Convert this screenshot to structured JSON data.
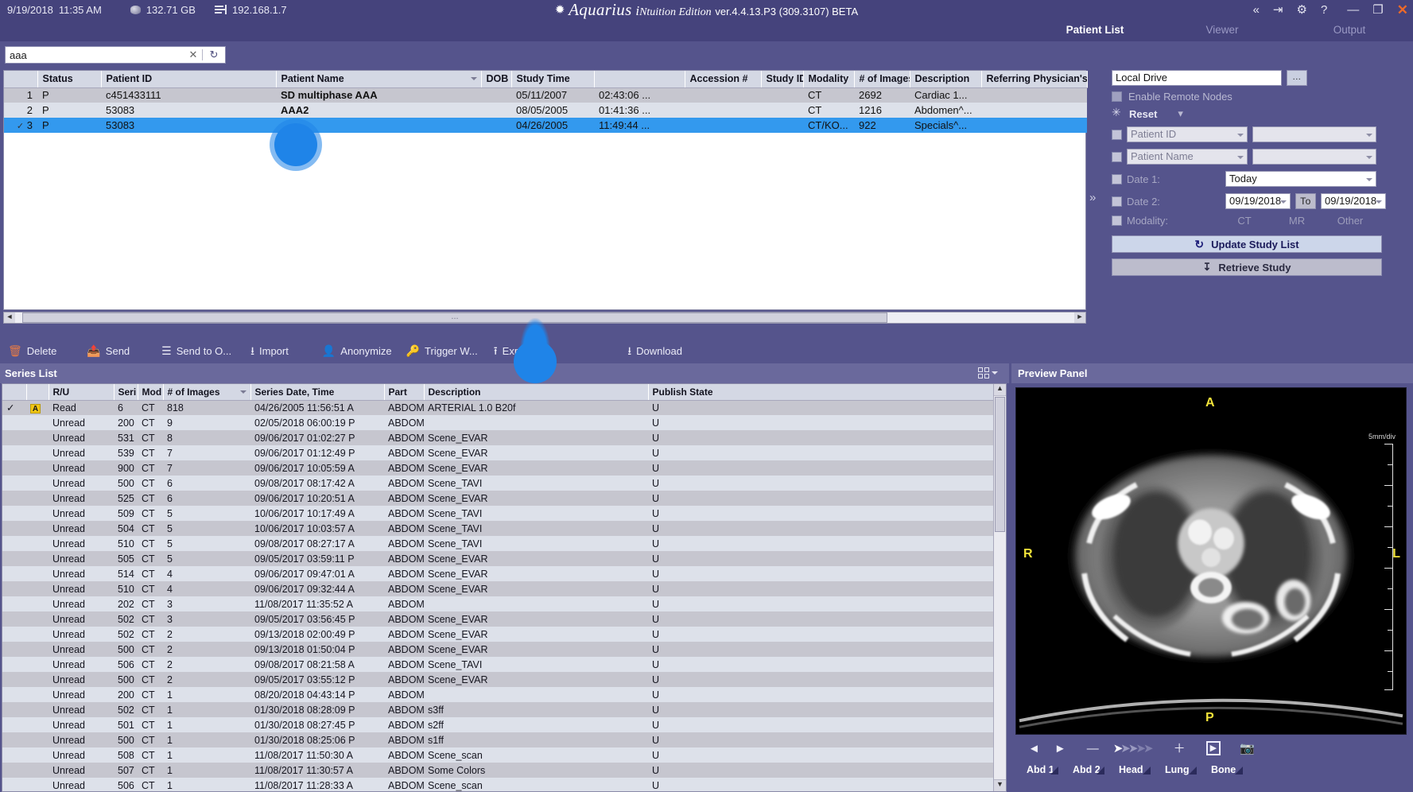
{
  "titlebar": {
    "date": "9/19/2018",
    "time": "11:35 AM",
    "disk_icon": "disk-icon",
    "disk_space": "132.71 GB",
    "net_icon": "network-icon",
    "ip_address": "192.168.1.7",
    "app_star": "✹",
    "app_name": "Aquarius",
    "app_edition_i": "i",
    "app_edition": "Ntuition Edition",
    "version": "ver.4.4.13.P3 (309.3107) BETA",
    "controls": {
      "collapse": "«",
      "logout": "⇥",
      "settings": "⚙",
      "help": "?",
      "minimize": "—",
      "restore": "❐",
      "close": "✕"
    }
  },
  "tabs": [
    {
      "label": "Patient List",
      "active": true
    },
    {
      "label": "Viewer",
      "active": false
    },
    {
      "label": "Output",
      "active": false
    }
  ],
  "search": {
    "value": "aaa",
    "placeholder": "",
    "clear_icon": "✕",
    "refresh_icon": "↻"
  },
  "patient_list": {
    "columns": [
      "",
      "Status",
      "Patient ID",
      "Patient Name",
      "DOB",
      "Study Time",
      "",
      "Accession #",
      "Study ID",
      "Modality",
      "# of Images",
      "Description",
      "Referring Physician's Nam"
    ],
    "rows": [
      {
        "check": "",
        "num": "1",
        "status": "P",
        "patient_id": "c451433111",
        "patient_name": "SD multiphase AAA",
        "dob": "",
        "study_date": "05/11/2007",
        "study_time": "02:43:06 ...",
        "accession": "",
        "study_id": "",
        "modality": "CT",
        "images": "2692",
        "description": "Cardiac 1...",
        "referring": "",
        "selected": false
      },
      {
        "check": "",
        "num": "2",
        "status": "P",
        "patient_id": "53083",
        "patient_name": "AAA2",
        "dob": "",
        "study_date": "08/05/2005",
        "study_time": "01:41:36 ...",
        "accession": "",
        "study_id": "",
        "modality": "CT",
        "images": "1216",
        "description": "Abdomen^...",
        "referring": "",
        "selected": false
      },
      {
        "check": "✓",
        "num": "3",
        "status": "P",
        "patient_id": "53083",
        "patient_name": "",
        "dob": "",
        "study_date": "04/26/2005",
        "study_time": "11:49:44 ...",
        "accession": "",
        "study_id": "",
        "modality": "CT/KO...",
        "images": "922",
        "description": "Specials^...",
        "referring": "",
        "selected": true
      }
    ]
  },
  "hscroll": {
    "left_arrow": "◄",
    "right_arrow": "►",
    "grip": "..."
  },
  "collapse_handle": "»",
  "query_panel": {
    "source_value": "Local Drive",
    "browse_label": "...",
    "enable_remote_nodes": "Enable Remote Nodes",
    "reset_label": "Reset",
    "reset_caret": "▾",
    "filter1_field": "Patient ID",
    "filter1_value": "",
    "filter2_field": "Patient Name",
    "filter2_value": "",
    "date1_label": "Date 1:",
    "date1_value": "Today",
    "date2_label": "Date 2:",
    "date2_from": "09/19/2018",
    "date2_to_label": "To",
    "date2_to": "09/19/2018",
    "modality_label": "Modality:",
    "modality_options": [
      "CT",
      "MR",
      "Other"
    ],
    "update_button": "Update Study List",
    "retrieve_button": "Retrieve Study"
  },
  "actionbar": [
    {
      "label": "Delete",
      "icon": "trash-icon"
    },
    {
      "label": "Send",
      "icon": "send-icon"
    },
    {
      "label": "Send to O...",
      "icon": "send-to-other-icon"
    },
    {
      "label": "Import",
      "icon": "import-icon"
    },
    {
      "label": "Anonymize",
      "icon": "person-icon"
    },
    {
      "label": "Trigger W...",
      "icon": "key-icon"
    },
    {
      "label": "Export",
      "icon": "export-icon"
    },
    {
      "label": "",
      "icon": "hidden-icon"
    },
    {
      "label": "Download",
      "icon": "download-icon"
    }
  ],
  "series_list": {
    "title": "Series List",
    "grid_toggle_icon": "grid-view-icon",
    "columns": [
      "",
      "",
      "R/U",
      "Seri",
      "Mod",
      "# of Images",
      "Series Date, Time",
      "Part",
      "Description",
      "Publish State"
    ],
    "rows": [
      {
        "check": "✓",
        "warn": "A",
        "ru": "Read",
        "seri": "6",
        "mod": "CT",
        "images": "818",
        "date": "04/26/2005",
        "time": "11:56:51 A",
        "part": "ABDOMEN",
        "description": "ARTERIAL  1.0  B20f",
        "publish": "U"
      },
      {
        "check": "",
        "warn": "",
        "ru": "Unread",
        "seri": "200",
        "mod": "CT",
        "images": "9",
        "date": "02/05/2018",
        "time": "06:00:19 P",
        "part": "ABDOMEN",
        "description": "",
        "publish": "U"
      },
      {
        "check": "",
        "warn": "",
        "ru": "Unread",
        "seri": "531",
        "mod": "CT",
        "images": "8",
        "date": "09/06/2017",
        "time": "01:02:27 P",
        "part": "ABDOMEN",
        "description": "Scene_EVAR",
        "publish": "U"
      },
      {
        "check": "",
        "warn": "",
        "ru": "Unread",
        "seri": "539",
        "mod": "CT",
        "images": "7",
        "date": "09/06/2017",
        "time": "01:12:49 P",
        "part": "ABDOMEN",
        "description": "Scene_EVAR",
        "publish": "U"
      },
      {
        "check": "",
        "warn": "",
        "ru": "Unread",
        "seri": "900",
        "mod": "CT",
        "images": "7",
        "date": "09/06/2017",
        "time": "10:05:59 A",
        "part": "ABDOMEN",
        "description": "Scene_EVAR",
        "publish": "U"
      },
      {
        "check": "",
        "warn": "",
        "ru": "Unread",
        "seri": "500",
        "mod": "CT",
        "images": "6",
        "date": "09/08/2017",
        "time": "08:17:42 A",
        "part": "ABDOMEN",
        "description": "Scene_TAVI",
        "publish": "U"
      },
      {
        "check": "",
        "warn": "",
        "ru": "Unread",
        "seri": "525",
        "mod": "CT",
        "images": "6",
        "date": "09/06/2017",
        "time": "10:20:51 A",
        "part": "ABDOMEN",
        "description": "Scene_EVAR",
        "publish": "U"
      },
      {
        "check": "",
        "warn": "",
        "ru": "Unread",
        "seri": "509",
        "mod": "CT",
        "images": "5",
        "date": "10/06/2017",
        "time": "10:17:49 A",
        "part": "ABDOMEN",
        "description": "Scene_TAVI",
        "publish": "U"
      },
      {
        "check": "",
        "warn": "",
        "ru": "Unread",
        "seri": "504",
        "mod": "CT",
        "images": "5",
        "date": "10/06/2017",
        "time": "10:03:57 A",
        "part": "ABDOMEN",
        "description": "Scene_TAVI",
        "publish": "U"
      },
      {
        "check": "",
        "warn": "",
        "ru": "Unread",
        "seri": "510",
        "mod": "CT",
        "images": "5",
        "date": "09/08/2017",
        "time": "08:27:17 A",
        "part": "ABDOMEN",
        "description": "Scene_TAVI",
        "publish": "U"
      },
      {
        "check": "",
        "warn": "",
        "ru": "Unread",
        "seri": "505",
        "mod": "CT",
        "images": "5",
        "date": "09/05/2017",
        "time": "03:59:11 P",
        "part": "ABDOMEN",
        "description": "Scene_EVAR",
        "publish": "U"
      },
      {
        "check": "",
        "warn": "",
        "ru": "Unread",
        "seri": "514",
        "mod": "CT",
        "images": "4",
        "date": "09/06/2017",
        "time": "09:47:01 A",
        "part": "ABDOMEN",
        "description": "Scene_EVAR",
        "publish": "U"
      },
      {
        "check": "",
        "warn": "",
        "ru": "Unread",
        "seri": "510",
        "mod": "CT",
        "images": "4",
        "date": "09/06/2017",
        "time": "09:32:44 A",
        "part": "ABDOMEN",
        "description": "Scene_EVAR",
        "publish": "U"
      },
      {
        "check": "",
        "warn": "",
        "ru": "Unread",
        "seri": "202",
        "mod": "CT",
        "images": "3",
        "date": "11/08/2017",
        "time": "11:35:52 A",
        "part": "ABDOMEN",
        "description": "",
        "publish": "U"
      },
      {
        "check": "",
        "warn": "",
        "ru": "Unread",
        "seri": "502",
        "mod": "CT",
        "images": "3",
        "date": "09/05/2017",
        "time": "03:56:45 P",
        "part": "ABDOMEN",
        "description": "Scene_EVAR",
        "publish": "U"
      },
      {
        "check": "",
        "warn": "",
        "ru": "Unread",
        "seri": "502",
        "mod": "CT",
        "images": "2",
        "date": "09/13/2018",
        "time": "02:00:49 P",
        "part": "ABDOMEN",
        "description": "Scene_EVAR",
        "publish": "U"
      },
      {
        "check": "",
        "warn": "",
        "ru": "Unread",
        "seri": "500",
        "mod": "CT",
        "images": "2",
        "date": "09/13/2018",
        "time": "01:50:04 P",
        "part": "ABDOMEN",
        "description": "Scene_EVAR",
        "publish": "U"
      },
      {
        "check": "",
        "warn": "",
        "ru": "Unread",
        "seri": "506",
        "mod": "CT",
        "images": "2",
        "date": "09/08/2017",
        "time": "08:21:58 A",
        "part": "ABDOMEN",
        "description": "Scene_TAVI",
        "publish": "U"
      },
      {
        "check": "",
        "warn": "",
        "ru": "Unread",
        "seri": "500",
        "mod": "CT",
        "images": "2",
        "date": "09/05/2017",
        "time": "03:55:12 P",
        "part": "ABDOMEN",
        "description": "Scene_EVAR",
        "publish": "U"
      },
      {
        "check": "",
        "warn": "",
        "ru": "Unread",
        "seri": "200",
        "mod": "CT",
        "images": "1",
        "date": "08/20/2018",
        "time": "04:43:14 P",
        "part": "ABDOMEN",
        "description": "",
        "publish": "U"
      },
      {
        "check": "",
        "warn": "",
        "ru": "Unread",
        "seri": "502",
        "mod": "CT",
        "images": "1",
        "date": "01/30/2018",
        "time": "08:28:09 P",
        "part": "ABDOMEN",
        "description": "s3ff",
        "publish": "U"
      },
      {
        "check": "",
        "warn": "",
        "ru": "Unread",
        "seri": "501",
        "mod": "CT",
        "images": "1",
        "date": "01/30/2018",
        "time": "08:27:45 P",
        "part": "ABDOMEN",
        "description": "s2ff",
        "publish": "U"
      },
      {
        "check": "",
        "warn": "",
        "ru": "Unread",
        "seri": "500",
        "mod": "CT",
        "images": "1",
        "date": "01/30/2018",
        "time": "08:25:06 P",
        "part": "ABDOMEN",
        "description": "s1ff",
        "publish": "U"
      },
      {
        "check": "",
        "warn": "",
        "ru": "Unread",
        "seri": "508",
        "mod": "CT",
        "images": "1",
        "date": "11/08/2017",
        "time": "11:50:30 A",
        "part": "ABDOMEN",
        "description": "Scene_scan",
        "publish": "U"
      },
      {
        "check": "",
        "warn": "",
        "ru": "Unread",
        "seri": "507",
        "mod": "CT",
        "images": "1",
        "date": "11/08/2017",
        "time": "11:30:57 A",
        "part": "ABDOMEN",
        "description": "Some Colors",
        "publish": "U"
      },
      {
        "check": "",
        "warn": "",
        "ru": "Unread",
        "seri": "506",
        "mod": "CT",
        "images": "1",
        "date": "11/08/2017",
        "time": "11:28:33 A",
        "part": "ABDOMEN",
        "description": "Scene_scan",
        "publish": "U"
      }
    ]
  },
  "preview_panel": {
    "title": "Preview Panel",
    "orientation": {
      "anterior": "A",
      "posterior": "P",
      "right": "R",
      "left": "L"
    },
    "scale_label": "5mm/div",
    "toolbar": [
      {
        "icon": "prev-image-icon",
        "glyph": "◄"
      },
      {
        "icon": "next-image-icon",
        "glyph": "►"
      },
      {
        "icon": "zoom-out-icon",
        "glyph": "—"
      },
      {
        "icon": "fast-forward-icon",
        "glyph": "➤"
      },
      {
        "icon": "zoom-in-icon",
        "glyph": "＋"
      },
      {
        "icon": "cine-play-icon",
        "glyph": "▶"
      },
      {
        "icon": "camera-icon",
        "glyph": "■"
      }
    ],
    "presets": [
      "Abd 1",
      "Abd 2",
      "Head",
      "Lung",
      "Bone"
    ]
  },
  "colors": {
    "chrome": "#55548c",
    "titlebar": "#45437c",
    "selection": "#3399ee",
    "header_row": "#d4d8e4",
    "row_even": "#c6c6cf",
    "row_odd": "#dde1ea",
    "accent_close": "#ef6a28",
    "annotation_yellow": "#f2e33a",
    "warning_badge": "#f2c613"
  }
}
